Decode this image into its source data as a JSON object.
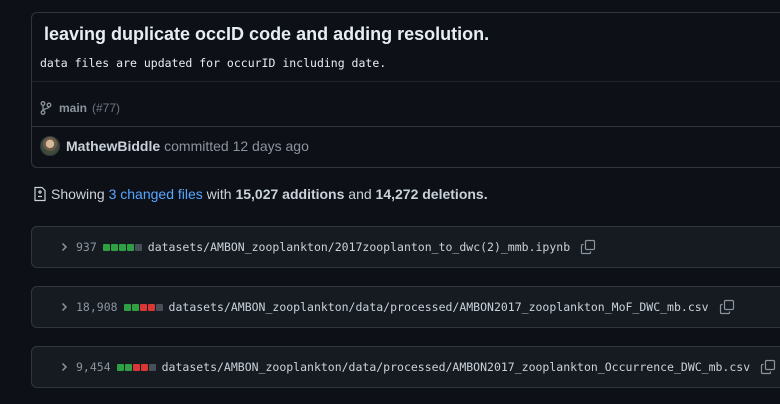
{
  "commit": {
    "title": "leaving duplicate occID code and adding resolution.",
    "description": "data files are updated for occurID including date.",
    "branch": "main",
    "pr_ref": "(#77)",
    "author": "MathewBiddle",
    "committed_text": "committed 12 days ago"
  },
  "summary": {
    "prefix": "Showing",
    "changed_files": "3 changed files",
    "with": "with",
    "additions": "15,027 additions",
    "and": "and",
    "deletions": "14,272 deletions."
  },
  "files": [
    {
      "count": "937",
      "path": "datasets/AMBON_zooplankton/2017zooplanton_to_dwc(2)_mmb.ipynb",
      "diffstat": [
        "green",
        "green",
        "green",
        "green",
        "gray"
      ]
    },
    {
      "count": "18,908",
      "path": "datasets/AMBON_zooplankton/data/processed/AMBON2017_zooplankton_MoF_DWC_mb.csv",
      "diffstat": [
        "green",
        "green",
        "red",
        "red",
        "gray"
      ]
    },
    {
      "count": "9,454",
      "path": "datasets/AMBON_zooplankton/data/processed/AMBON2017_zooplankton_Occurrence_DWC_mb.csv",
      "diffstat": [
        "green",
        "green",
        "red",
        "red",
        "gray"
      ]
    }
  ],
  "colors": {
    "green": "#2ea043",
    "red": "#da3633",
    "gray": "#484f58",
    "link": "#58a6ff"
  },
  "icons": {
    "branch": "git-branch-icon",
    "diff": "file-diff-icon",
    "chevron": "chevron-right-icon",
    "copy": "copy-icon"
  }
}
